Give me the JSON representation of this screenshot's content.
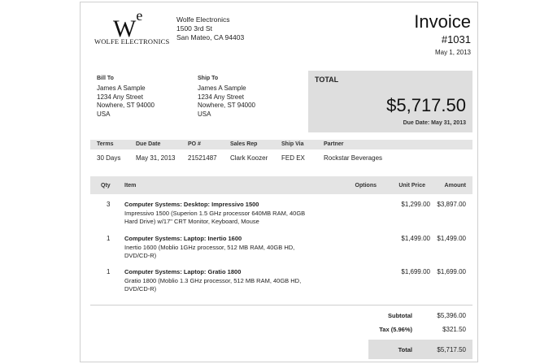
{
  "company": {
    "logo_mark": "W",
    "logo_sup": "e",
    "logo_name": "WOLFE ELECTRONICS",
    "name": "Wolfe Electronics",
    "street": "1500 3rd St",
    "city": "San Mateo, CA 94403"
  },
  "invoice": {
    "title": "Invoice",
    "number": "#1031",
    "date": "May 1, 2013"
  },
  "bill_to": {
    "label": "Bill To",
    "lines": [
      "James A Sample",
      "1234 Any Street",
      "Nowhere, ST 94000",
      "USA"
    ]
  },
  "ship_to": {
    "label": "Ship To",
    "lines": [
      "James A Sample",
      "1234 Any Street",
      "Nowhere, ST 94000",
      "USA"
    ]
  },
  "total_box": {
    "label": "TOTAL",
    "amount": "$5,717.50",
    "due": "Due Date: May 31, 2013"
  },
  "terms_table": {
    "headers": [
      "Terms",
      "Due Date",
      "PO #",
      "Sales Rep",
      "Ship Via",
      "Partner"
    ],
    "values": [
      "30 Days",
      "May 31, 2013",
      "21521487",
      "Clark Koozer",
      "FED EX",
      "Rockstar Beverages"
    ]
  },
  "items_table": {
    "headers": [
      "Qty",
      "Item",
      "Options",
      "Unit Price",
      "Amount"
    ],
    "rows": [
      {
        "qty": "3",
        "title": "Computer Systems: Desktop: Impressivo 1500",
        "desc": "Impressivo 1500 (Superion 1.5 GHz processor 640MB RAM, 40GB Hard Drive) w/17\" CRT Monitor, Keyboard, Mouse",
        "options": "",
        "unit_price": "$1,299.00",
        "amount": "$3,897.00"
      },
      {
        "qty": "1",
        "title": "Computer Systems: Laptop: Inertio 1600",
        "desc": "Inertio 1600 (Moblio 1GHz processor, 512 MB RAM, 40GB HD, DVD/CD-R)",
        "options": "",
        "unit_price": "$1,499.00",
        "amount": "$1,499.00"
      },
      {
        "qty": "1",
        "title": "Computer Systems: Laptop: Gratio 1800",
        "desc": "Gratio 1800 (Moblio 1.3 GHz processor, 512 MB RAM, 40GB HD, DVD/CD-R)",
        "options": "",
        "unit_price": "$1,699.00",
        "amount": "$1,699.00"
      }
    ]
  },
  "summary": {
    "subtotal_label": "Subtotal",
    "subtotal": "$5,396.00",
    "tax_label": "Tax (5.96%)",
    "tax": "$321.50",
    "total_label": "Total",
    "total": "$5,717.50"
  }
}
